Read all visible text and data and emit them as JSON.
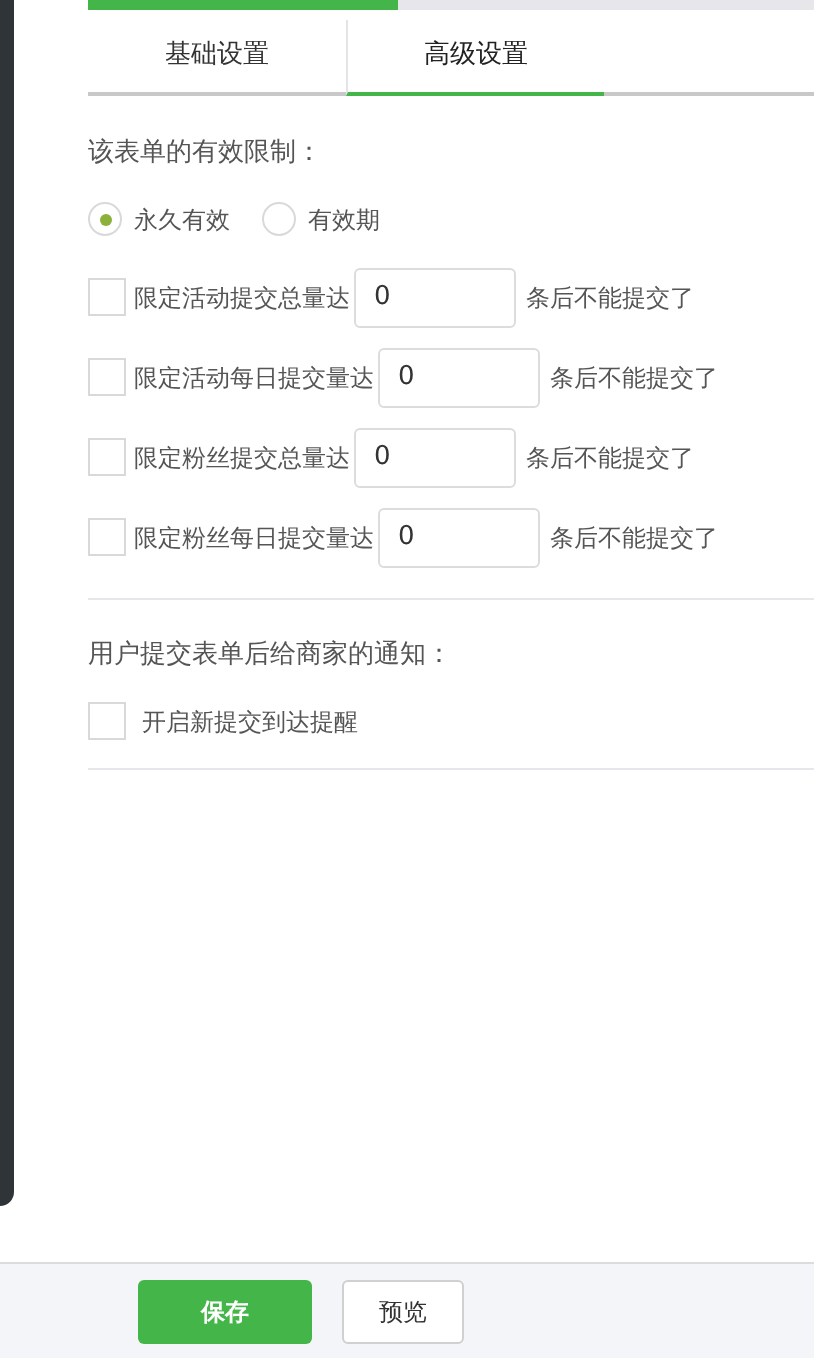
{
  "progress": {
    "level": 0.42
  },
  "tabs": [
    {
      "label": "基础设置",
      "selected": false
    },
    {
      "label": "高级设置",
      "selected": true
    }
  ],
  "validity": {
    "label": "该表单的有效限制：",
    "options": [
      {
        "label": "永久有效",
        "selected": true
      },
      {
        "label": "有效期",
        "selected": false
      }
    ]
  },
  "limits": [
    {
      "label": "限定活动提交总量达",
      "value": "0",
      "suffix": "条后不能提交了",
      "checked": false
    },
    {
      "label": "限定活动每日提交量达",
      "value": "0",
      "suffix": "条后不能提交了",
      "checked": false
    },
    {
      "label": "限定粉丝提交总量达",
      "value": "0",
      "suffix": "条后不能提交了",
      "checked": false
    },
    {
      "label": "限定粉丝每日提交量达",
      "value": "0",
      "suffix": "条后不能提交了",
      "checked": false
    }
  ],
  "notification": {
    "label": "用户提交表单后给商家的通知：",
    "options": [
      {
        "label": "开启新提交到达提醒",
        "checked": false
      }
    ]
  },
  "buttons": [
    {
      "label": "保存",
      "kind": "primary"
    },
    {
      "label": "预览",
      "kind": "secondary"
    }
  ]
}
